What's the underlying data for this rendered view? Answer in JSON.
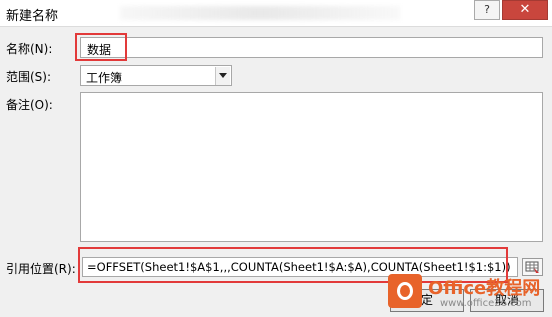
{
  "window": {
    "title": "新建名称",
    "help_label": "?",
    "close_label": "✕"
  },
  "form": {
    "name_label": "名称(N):",
    "name_value": "数据",
    "scope_label": "范围(S):",
    "scope_value": "工作簿",
    "comment_label": "备注(O):",
    "comment_value": "",
    "ref_label": "引用位置(R):",
    "ref_value": "=OFFSET(Sheet1!$A$1,,,COUNTA(Sheet1!$A:$A),COUNTA(Sheet1!$1:$1))"
  },
  "buttons": {
    "ok_label": "定",
    "cancel_label": "取消"
  },
  "watermark": {
    "name": "Office教程网",
    "site": "www.office26.com"
  },
  "colors": {
    "highlight": "#e23a3a",
    "close_button": "#c9463d",
    "brand": "#e8632a"
  }
}
